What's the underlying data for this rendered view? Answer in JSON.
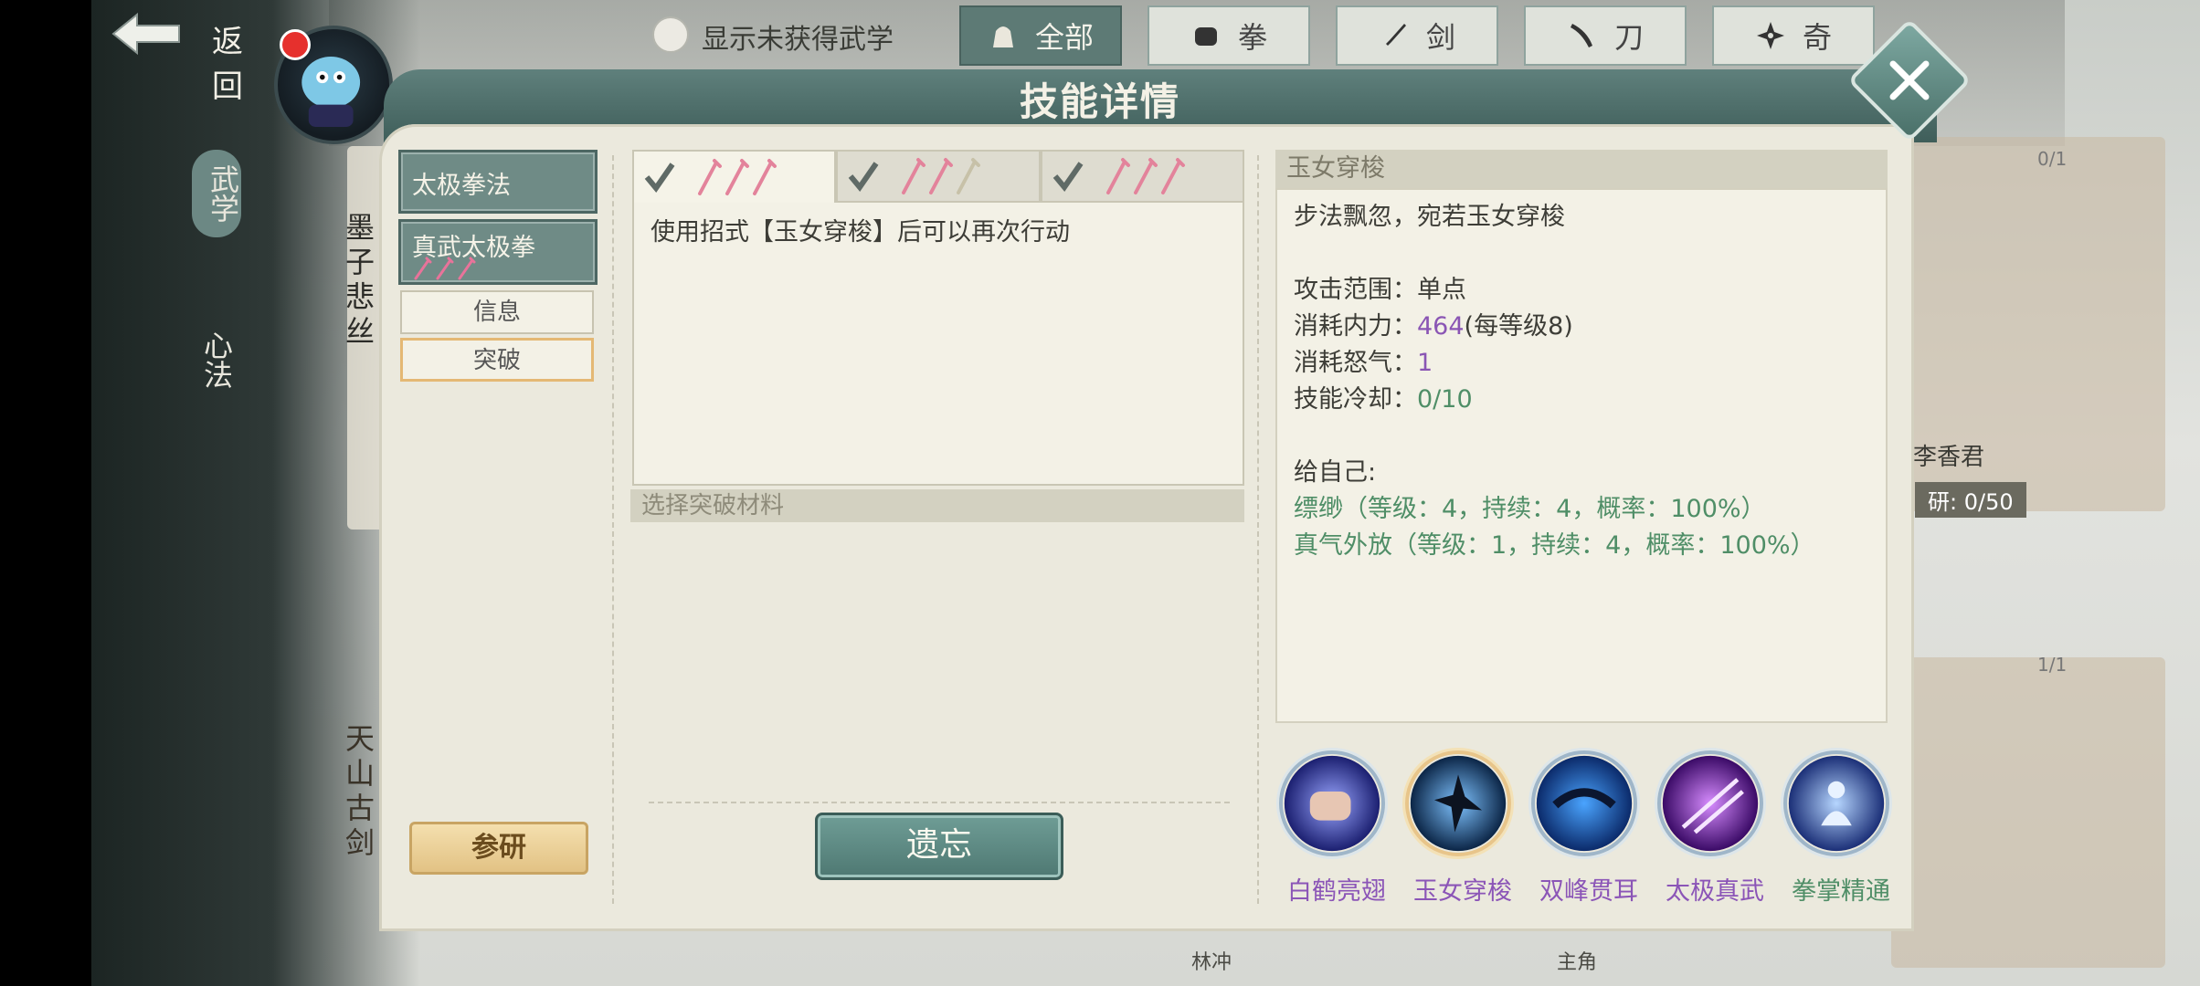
{
  "nav": {
    "back_label": "返回",
    "show_unobtained_label": "显示未获得武学",
    "side_tabs": [
      "武学",
      "心法"
    ],
    "filters": [
      {
        "label": "全部",
        "icon": "bag-icon",
        "active": true
      },
      {
        "label": "拳",
        "icon": "fist-icon",
        "active": false
      },
      {
        "label": "剑",
        "icon": "sword-icon",
        "active": false
      },
      {
        "label": "刀",
        "icon": "blade-icon",
        "active": false
      },
      {
        "label": "奇",
        "icon": "shuriken-icon",
        "active": false
      }
    ]
  },
  "background": {
    "left_card_text": "墨子悲丝",
    "left_card2_text": "天山古剑",
    "right_card_name": "李香君",
    "right_card_progress": "研: 0/50",
    "right_card_count_top": "0/1",
    "right_card_count_bottom": "1/1",
    "bottom_names": [
      "林冲",
      "主角"
    ]
  },
  "modal": {
    "title": "技能详情",
    "skill_list": [
      {
        "label": "太极拳法"
      },
      {
        "label": "真武太极拳"
      }
    ],
    "sub_buttons": [
      "信息",
      "突破"
    ],
    "study_label": "参研",
    "level_tabs": [
      {
        "checked": true,
        "active": true
      },
      {
        "checked": true,
        "active": false
      },
      {
        "checked": true,
        "active": false
      }
    ],
    "description": "使用招式【玉女穿梭】后可以再次行动",
    "breakthrough_section": "选择突破材料",
    "forget_label": "遗忘",
    "detail": {
      "name": "玉女穿梭",
      "flavor": "步法飘忽，宛若玉女穿梭",
      "range_label": "攻击范围：",
      "range_value": "单点",
      "mp_label": "消耗内力：",
      "mp_value": "464",
      "mp_extra": "(每等级8)",
      "rage_label": "消耗怒气：",
      "rage_value": "1",
      "cd_label": "技能冷却：",
      "cd_value": "0/10",
      "self_label": "给自己:",
      "effects": [
        "缥缈（等级：4，持续：4，概率：100%）",
        "真气外放（等级：1，持续：4，概率：100%）"
      ]
    },
    "skills": [
      {
        "name": "白鹤亮翅",
        "color": "purple",
        "current": false
      },
      {
        "name": "玉女穿梭",
        "color": "purple",
        "current": true
      },
      {
        "name": "双峰贯耳",
        "color": "purple",
        "current": false
      },
      {
        "name": "太极真武",
        "color": "purple",
        "current": false
      },
      {
        "name": "拳掌精通",
        "color": "green",
        "current": false
      }
    ]
  },
  "colors": {
    "accent_teal": "#5d7a75",
    "panel_bg": "#ebe9dd",
    "purple_value": "#8a55b4",
    "green_value": "#4f8e67"
  }
}
